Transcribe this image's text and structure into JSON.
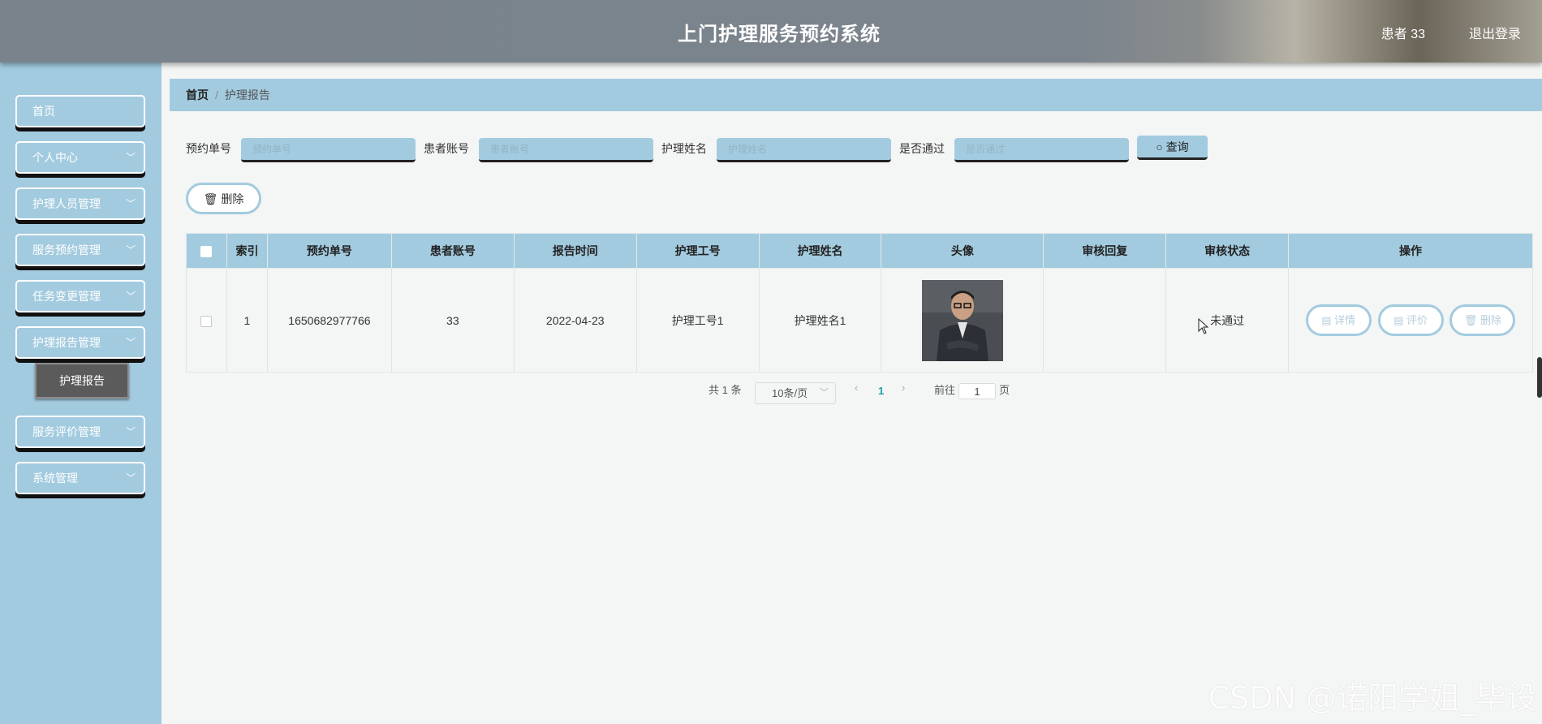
{
  "header": {
    "title": "上门护理服务预约系统",
    "user": "患者 33",
    "logout": "退出登录"
  },
  "sidebar": {
    "items": [
      {
        "label": "首页",
        "has_children": false
      },
      {
        "label": "个人中心",
        "has_children": true
      },
      {
        "label": "护理人员管理",
        "has_children": true
      },
      {
        "label": "服务预约管理",
        "has_children": true
      },
      {
        "label": "任务变更管理",
        "has_children": true
      },
      {
        "label": "护理报告管理",
        "has_children": true
      },
      {
        "label": "服务评价管理",
        "has_children": true
      },
      {
        "label": "系统管理",
        "has_children": true
      }
    ],
    "active_sub": "护理报告"
  },
  "breadcrumb": {
    "home": "首页",
    "current": "护理报告"
  },
  "search": {
    "fields": [
      {
        "label": "预约单号",
        "placeholder": "预约单号"
      },
      {
        "label": "患者账号",
        "placeholder": "患者账号"
      },
      {
        "label": "护理姓名",
        "placeholder": "护理姓名"
      },
      {
        "label": "是否通过",
        "placeholder": "是否通过"
      }
    ],
    "query_label": "查询"
  },
  "actions": {
    "delete_label": "删除"
  },
  "table": {
    "columns": [
      "索引",
      "预约单号",
      "患者账号",
      "报告时间",
      "护理工号",
      "护理姓名",
      "头像",
      "审核回复",
      "审核状态",
      "操作"
    ],
    "rows": [
      {
        "index": "1",
        "order_no": "1650682977766",
        "patient": "33",
        "time": "2022-04-23",
        "nurse_id": "护理工号1",
        "nurse_name": "护理姓名1",
        "reply": "",
        "status": "未通过",
        "ops": [
          "详情",
          "评价",
          "删除"
        ]
      }
    ]
  },
  "pagination": {
    "total": "共 1 条",
    "page_size": "10条/页",
    "current_page": "1",
    "goto_prefix": "前往",
    "goto_value": "1",
    "goto_suffix": "页"
  },
  "watermark": "CSDN @诺阳学姐_毕设",
  "colors": {
    "accent": "#a3cbdf",
    "header": "#7b848d",
    "active_sub": "#5b5b5b"
  }
}
